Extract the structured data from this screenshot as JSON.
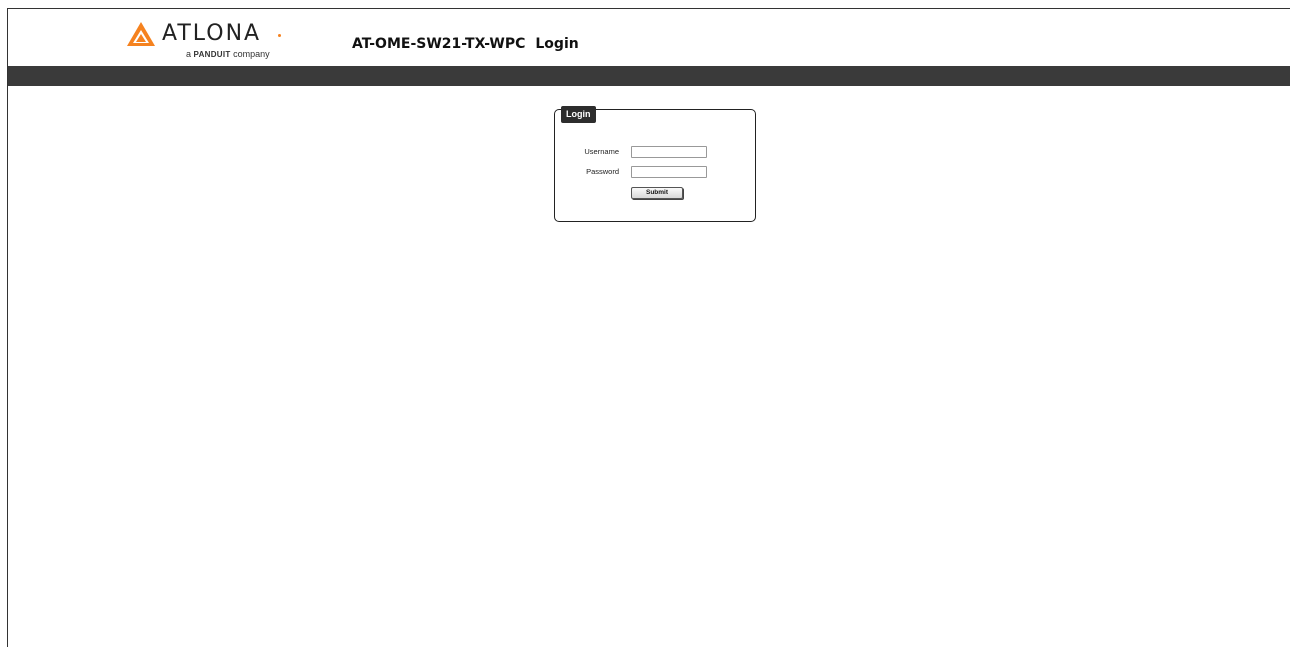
{
  "header": {
    "brand": "ATLONA",
    "subbrand_prefix": "a",
    "subbrand_company": "PANDUIT",
    "subbrand_suffix": "company",
    "model": "AT-OME-SW21-TX-WPC",
    "page_title": "Login"
  },
  "login": {
    "legend": "Login",
    "username_label": "Username",
    "username_value": "",
    "password_label": "Password",
    "password_value": "",
    "submit_label": "Submit"
  },
  "colors": {
    "logo_orange": "#f5821f",
    "navbar": "#3a3a3a",
    "legend_bg": "#2d2d2d"
  }
}
